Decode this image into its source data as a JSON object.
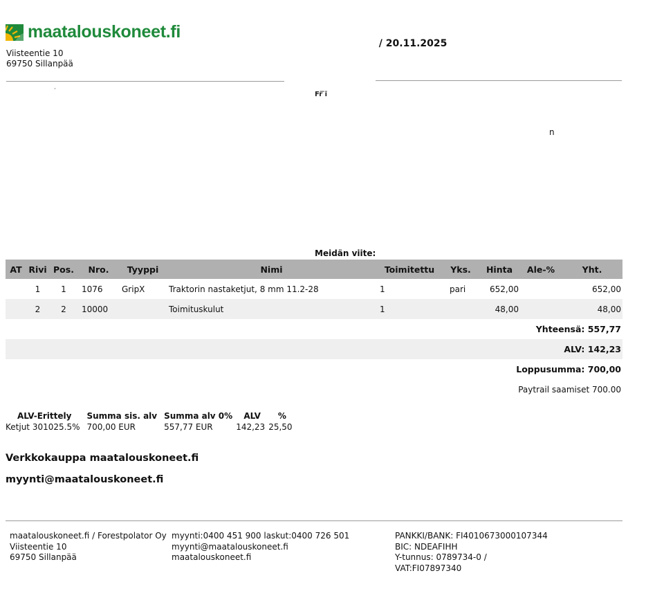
{
  "company": {
    "logo_text": "maatalouskoneet.fi",
    "street": "Viisteentie 10",
    "postal": "69750 Sillanpää"
  },
  "header": {
    "doc_id": " / 20.11.2025",
    "frag_mid": "Fr̄ ̄ı̄ ",
    "frag_right": "n",
    "reference_label": "Meidän viite:"
  },
  "items_table": {
    "columns": [
      "AT",
      "Rivi",
      "Pos.",
      "Nro.",
      "Tyyppi",
      "Nimi",
      "Toimitettu",
      "Yks.",
      "Hinta",
      "Ale-%",
      "Yht."
    ],
    "rows": [
      {
        "at": "",
        "rivi": "1",
        "pos": "1",
        "nro": "1076",
        "tyyppi": "GripX",
        "nimi": "Traktorin nastaketjut, 8 mm 11.2-28",
        "toimitettu": "1",
        "yks": "pari",
        "hinta": "652,00",
        "ale": "",
        "yht": "652,00"
      },
      {
        "at": "",
        "rivi": "2",
        "pos": "2",
        "nro": "10000",
        "tyyppi": "",
        "nimi": "Toimituskulut",
        "toimitettu": "1",
        "yks": "",
        "hinta": "48,00",
        "ale": "",
        "yht": "48,00"
      }
    ],
    "totals": {
      "subtotal": "Yhteensä: 557,77",
      "vat": "ALV: 142,23",
      "grand": "Loppusumma: 700,00",
      "paytrail": "Paytrail saamiset 700.00"
    }
  },
  "vat_breakdown": {
    "columns": [
      "ALV-Erittely",
      "Summa sis. alv",
      "Summa alv 0%",
      "ALV",
      "%"
    ],
    "row": [
      "Ketjut 301025.5%",
      "700,00 EUR",
      "557,77 EUR",
      "142,23",
      "25,50"
    ]
  },
  "shop": {
    "name": "Verkkokauppa maatalouskoneet.fi",
    "email": "myynti@maatalouskoneet.fi"
  },
  "footer": {
    "col1": [
      "maatalouskoneet.fi / Forestpolator Oy",
      "Viisteentie 10",
      "69750 Sillanpää"
    ],
    "col2": [
      "myynti:0400 451 900 laskut:0400 726 501",
      "myynti@maatalouskoneet.fi",
      "maatalouskoneet.fi"
    ],
    "col3": [
      "PANKKI/BANK: FI4010673000107344",
      "BIC: NDEAFIHH",
      "Y-tunnus: 0789734-0 /",
      "VAT:FI07897340"
    ]
  },
  "colors": {
    "brand": "#1f8a3b",
    "logo_sun": "#f2b705",
    "header_row": "#b0b0b0",
    "stripe": "#efefef"
  }
}
